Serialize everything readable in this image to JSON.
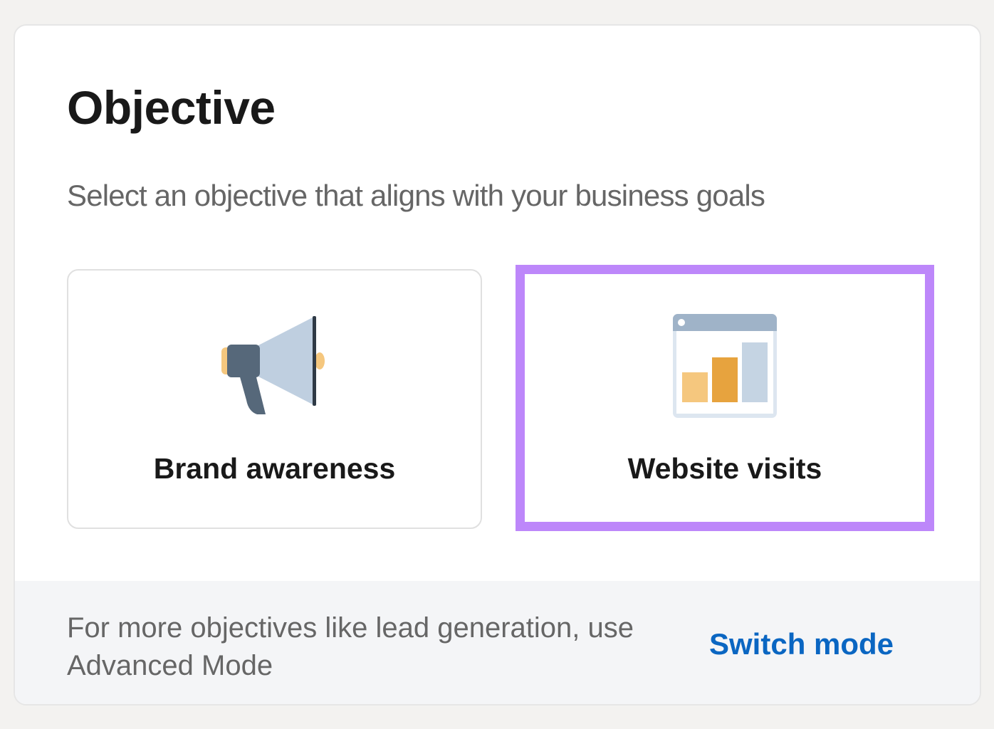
{
  "header": {
    "title": "Objective",
    "subtitle": "Select an objective that aligns with your business goals"
  },
  "options": [
    {
      "label": "Brand awareness",
      "icon": "megaphone-icon",
      "selected": false
    },
    {
      "label": "Website visits",
      "icon": "website-chart-icon",
      "selected": true
    }
  ],
  "footer": {
    "text": "For more objectives like lead generation, use Advanced Mode",
    "link_label": "Switch mode"
  },
  "colors": {
    "selection_highlight": "#bd87fa",
    "link": "#0a66c2",
    "title_text": "#191919",
    "muted_text": "#666666",
    "footer_background": "#f4f5f7"
  }
}
